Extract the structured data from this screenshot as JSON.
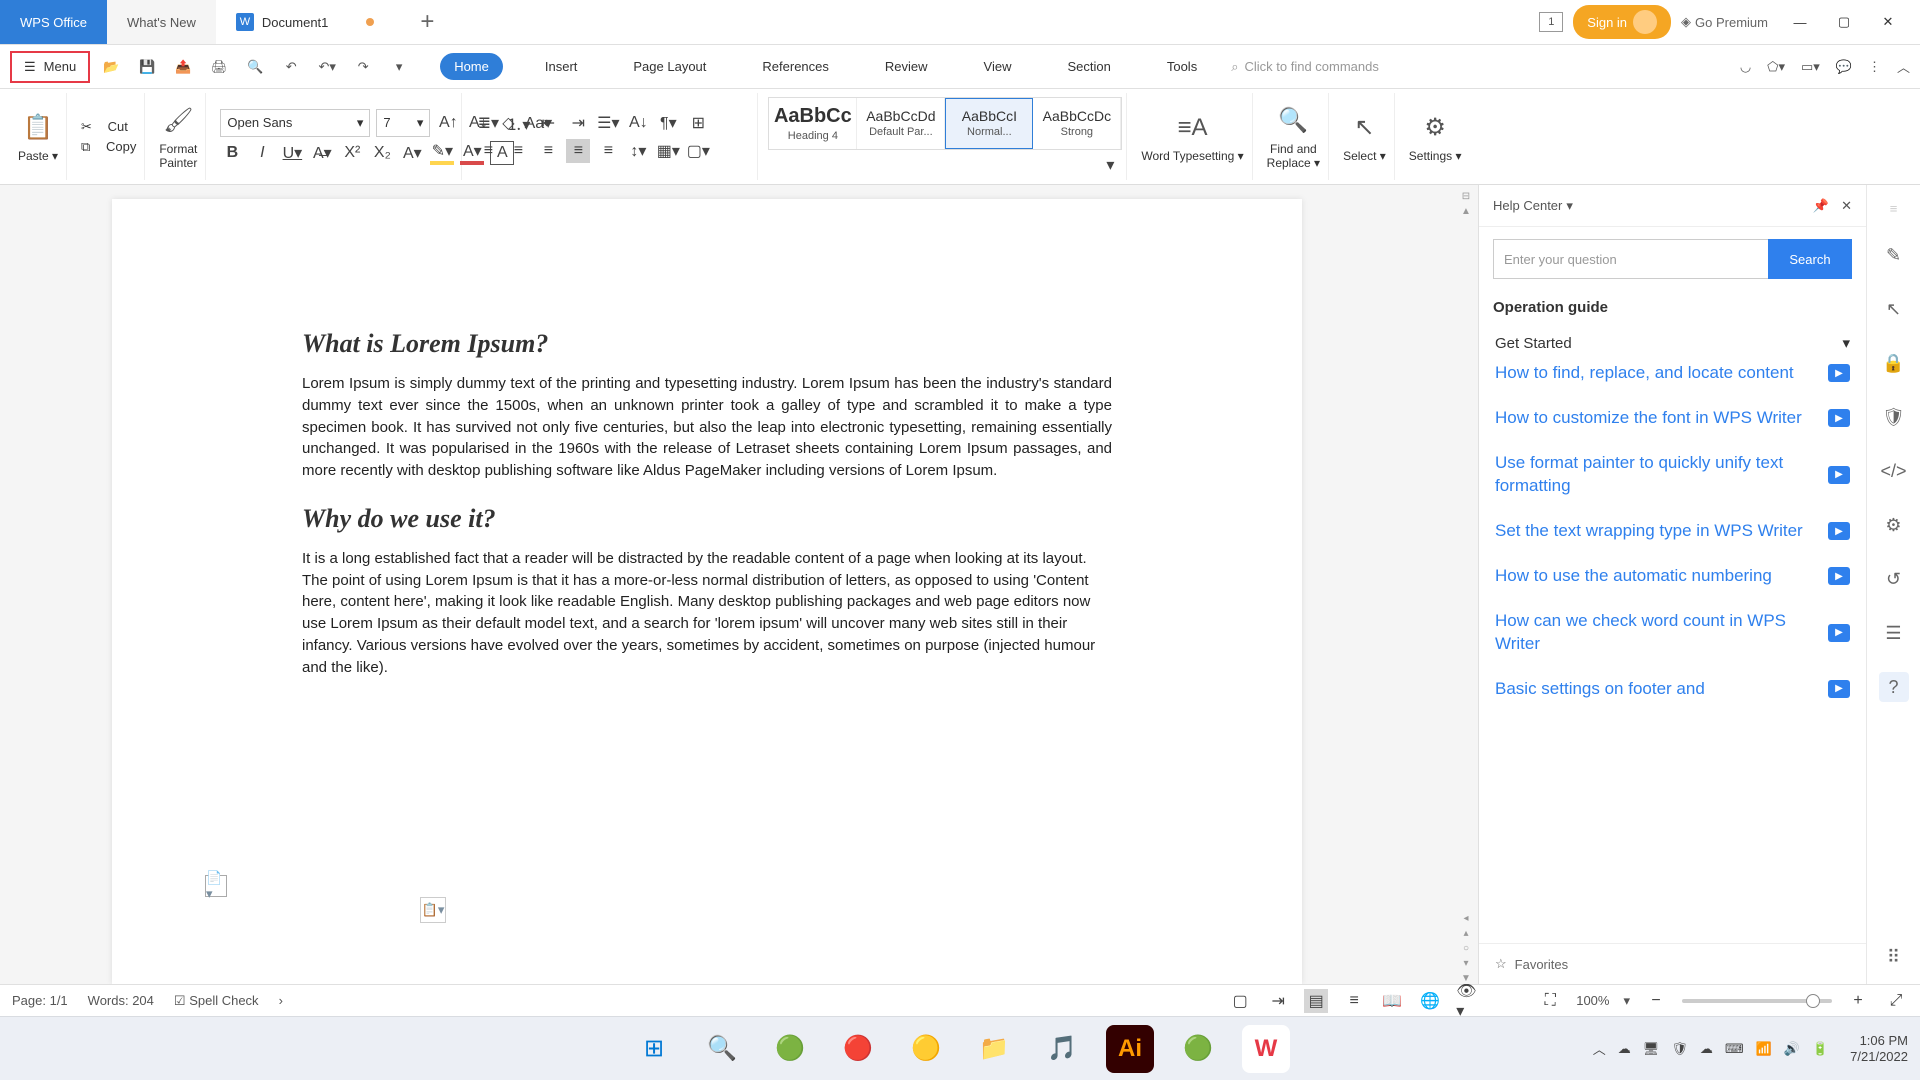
{
  "titlebar": {
    "app_tab": "WPS Office",
    "whatsnew_tab": "What's New",
    "doc_tab": "Document1",
    "signin": "Sign in",
    "go_premium": "Go Premium"
  },
  "menubar": {
    "menu_label": "Menu",
    "tabs": [
      "Home",
      "Insert",
      "Page Layout",
      "References",
      "Review",
      "View",
      "Section",
      "Tools"
    ],
    "search_placeholder": "Click to find commands"
  },
  "ribbon": {
    "paste": "Paste",
    "cut": "Cut",
    "copy": "Copy",
    "format_painter": "Format\nPainter",
    "font_name": "Open Sans",
    "font_size": "7",
    "styles": [
      {
        "preview": "AaBbCc",
        "name": "Heading 4",
        "big": true
      },
      {
        "preview": "AaBbCcDd",
        "name": "Default Par..."
      },
      {
        "preview": "AaBbCcI",
        "name": "Normal..."
      },
      {
        "preview": "AaBbCcDc",
        "name": "Strong"
      }
    ],
    "word_typesetting": "Word Typesetting",
    "find_replace": "Find and\nReplace",
    "select": "Select",
    "settings": "Settings"
  },
  "document": {
    "h1": "What is Lorem Ipsum?",
    "p1": "Lorem Ipsum is simply dummy text of the printing and typesetting industry. Lorem Ipsum has been the industry's standard dummy text ever since the 1500s, when an unknown printer took a galley of type and scrambled it to make a type specimen book. It has survived not only five centuries, but also the leap into electronic typesetting, remaining essentially unchanged. It was popularised in the 1960s with the release of Letraset sheets containing Lorem Ipsum passages, and more recently with desktop publishing software like Aldus PageMaker including versions of Lorem Ipsum.",
    "h2": "Why do we use it?",
    "p2": "It is a long established fact that a reader will be distracted by the readable content of a page when looking at its layout. The point of using Lorem Ipsum is that it has a more-or-less normal distribution of letters, as opposed to using 'Content here, content here', making it look like readable English. Many desktop publishing packages and web page editors now use Lorem Ipsum as their default model text, and a search for 'lorem ipsum' will uncover many web sites still in their infancy. Various versions have evolved over the years, sometimes by accident, sometimes on purpose (injected humour and the like)."
  },
  "help": {
    "title": "Help Center",
    "search_placeholder": "Enter your question",
    "search_btn": "Search",
    "guide_title": "Operation guide",
    "get_started": "Get Started",
    "links": [
      "How to find, replace, and locate content",
      "How to customize the font in WPS Writer",
      "Use format painter to quickly unify text formatting",
      "Set the text wrapping type in WPS Writer",
      "How to use the automatic numbering",
      "How can we check word count in WPS Writer",
      "Basic settings on footer and"
    ],
    "favorites": "Favorites"
  },
  "statusbar": {
    "page": "Page: 1/1",
    "words": "Words: 204",
    "spell": "Spell Check",
    "zoom": "100%"
  },
  "taskbar": {
    "time": "1:06 PM",
    "date": "7/21/2022"
  }
}
